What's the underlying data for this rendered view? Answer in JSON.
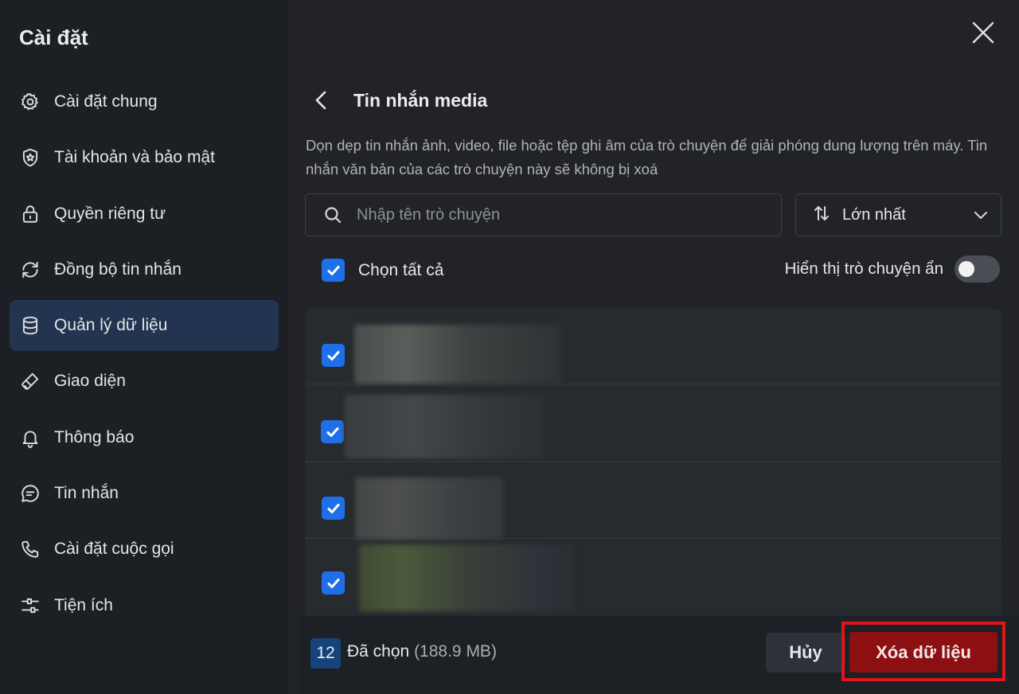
{
  "sidebar": {
    "title": "Cài đặt",
    "items": [
      {
        "label": "Cài đặt chung",
        "icon": "gear-icon"
      },
      {
        "label": "Tài khoản và bảo mật",
        "icon": "shield-icon"
      },
      {
        "label": "Quyền riêng tư",
        "icon": "lock-icon"
      },
      {
        "label": "Đồng bộ tin nhắn",
        "icon": "sync-icon"
      },
      {
        "label": "Quản lý dữ liệu",
        "icon": "database-icon",
        "active": true
      },
      {
        "label": "Giao diện",
        "icon": "brush-icon"
      },
      {
        "label": "Thông báo",
        "icon": "bell-icon"
      },
      {
        "label": "Tin nhắn",
        "icon": "chat-icon"
      },
      {
        "label": "Cài đặt cuộc gọi",
        "icon": "phone-icon"
      },
      {
        "label": "Tiện ích",
        "icon": "sliders-icon"
      }
    ]
  },
  "main": {
    "title": "Tin nhắn media",
    "description": "Dọn dẹp tin nhắn ảnh, video, file hoặc tệp ghi âm của trò chuyện để giải phóng dung lượng trên máy. Tin nhắn văn bản của các trò chuyện này sẽ không bị xoá",
    "search": {
      "placeholder": "Nhập tên trò chuyện",
      "value": ""
    },
    "sort": {
      "label": "Lớn nhất"
    },
    "select_all": {
      "label": "Chọn tất cả",
      "checked": true
    },
    "show_hidden": {
      "label": "Hiển thị trò chuyện ẩn",
      "on": false
    },
    "conversations": [
      {
        "checked": true,
        "name": ""
      },
      {
        "checked": true,
        "name": ""
      },
      {
        "checked": true,
        "name": ""
      },
      {
        "checked": true,
        "name": ""
      }
    ]
  },
  "footer": {
    "count": "12",
    "selected_label": "Đã chọn",
    "selected_size": "(188.9 MB)",
    "cancel_label": "Hủy",
    "delete_label": "Xóa dữ liệu"
  },
  "colors": {
    "accent": "#1f6fe8",
    "danger": "#8c0f12",
    "highlight": "#e0141b",
    "active_nav": "#22344f"
  }
}
